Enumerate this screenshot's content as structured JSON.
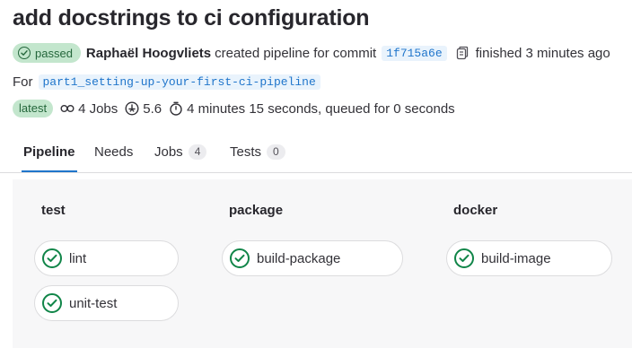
{
  "pipeline": {
    "title": "add docstrings to ci configuration",
    "status_label": "passed",
    "author": "Raphaël Hoogvliets",
    "created_text": "created pipeline for commit",
    "commit_sha": "1f715a6e",
    "finished_text": "finished 3 minutes ago",
    "for_label": "For",
    "branch": "part1_setting-up-your-first-ci-pipeline",
    "latest_badge": "latest",
    "jobs_count": "4 Jobs",
    "compute": "5.6",
    "duration": "4 minutes 15 seconds, queued for 0 seconds"
  },
  "tabs": {
    "pipeline": "Pipeline",
    "needs": "Needs",
    "jobs": "Jobs",
    "jobs_count": "4",
    "tests": "Tests",
    "tests_count": "0"
  },
  "stages": [
    {
      "name": "test",
      "jobs": [
        "lint",
        "unit-test"
      ]
    },
    {
      "name": "package",
      "jobs": [
        "build-package"
      ]
    },
    {
      "name": "docker",
      "jobs": [
        "build-image"
      ]
    }
  ],
  "colors": {
    "success": "#108548",
    "badge_bg": "#c3e6cd",
    "link": "#1f75cb",
    "active_tab_underline": "#1f75cb"
  },
  "icons": {
    "status": "check-circle-icon",
    "copy": "copy-icon",
    "jobs": "pipeline-icon",
    "compute": "compute-icon",
    "duration": "timer-icon"
  }
}
